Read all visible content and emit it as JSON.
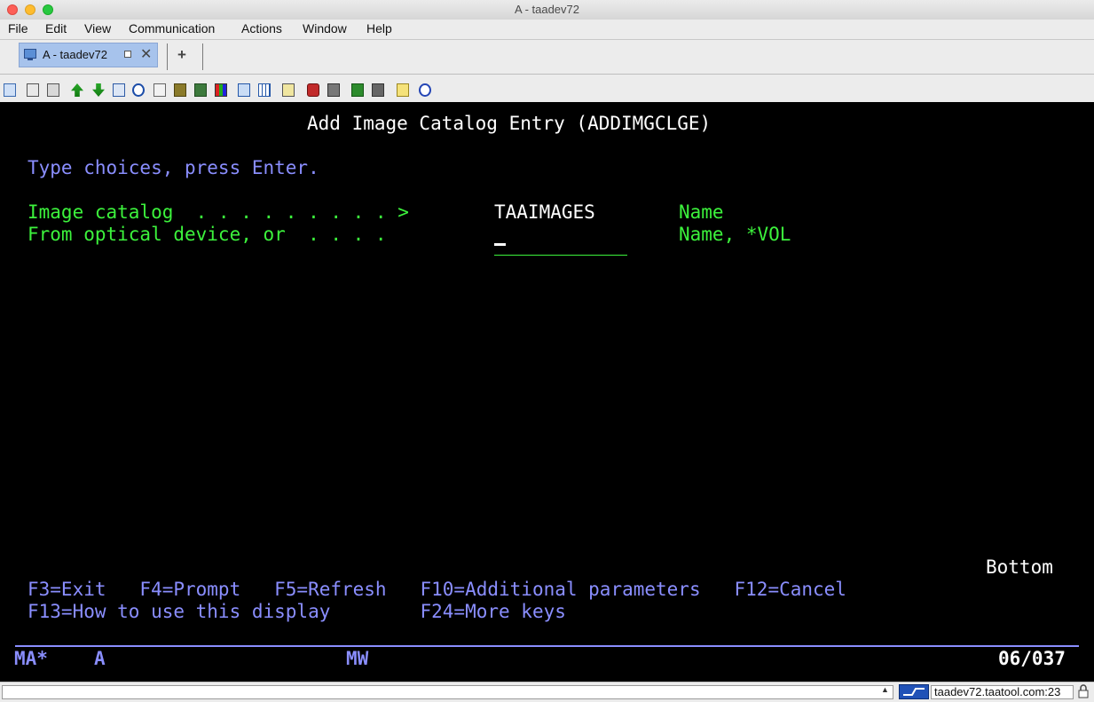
{
  "window": {
    "title": "A - taadev72"
  },
  "menu": [
    "File",
    "Edit",
    "View",
    "Communication",
    "Actions",
    "Window",
    "Help"
  ],
  "tab": {
    "label": "A - taadev72",
    "close_glyph": "✕",
    "new_tab_glyph": "+"
  },
  "toolbar_icons": [
    "copy-icon",
    "copy-append-icon",
    "paste-icon",
    "send-file-icon",
    "receive-file-icon",
    "print-icon",
    "navigator-icon",
    "print-screen-icon",
    "macro-icon",
    "keypad-icon",
    "color-icon",
    "session-icon",
    "keyboard-map-icon",
    "calendar-icon",
    "ruler-icon",
    "record-macro-icon",
    "stop-macro-icon",
    "play-macro-icon",
    "pause-macro-icon",
    "notes-icon",
    "help-icon"
  ],
  "screen": {
    "title": "Add Image Catalog Entry (ADDIMGCLGE)",
    "instruction": "Type choices, press Enter.",
    "field1": {
      "label": "Image catalog  . . . . . . . . . > ",
      "value": "TAAIMAGES",
      "hint": "Name"
    },
    "field2": {
      "label": "From optical device, or  . . . .",
      "value": "",
      "hint": "Name, *VOL"
    },
    "position": "Bottom",
    "fkeys_line1": "F3=Exit   F4=Prompt   F5=Refresh   F10=Additional parameters   F12=Cancel",
    "fkeys_line2": "F13=How to use this display        F24=More keys"
  },
  "oia": {
    "status": "MA*",
    "session": "A",
    "mode": "MW",
    "cursor_pos": "06/037"
  },
  "statusbar": {
    "host": "taadev72.taatool.com:23"
  },
  "colors": {
    "terminal_bg": "#000000",
    "field_green": "#3cf23c",
    "text_blue": "#8a8eff",
    "text_white": "#ffffff"
  }
}
